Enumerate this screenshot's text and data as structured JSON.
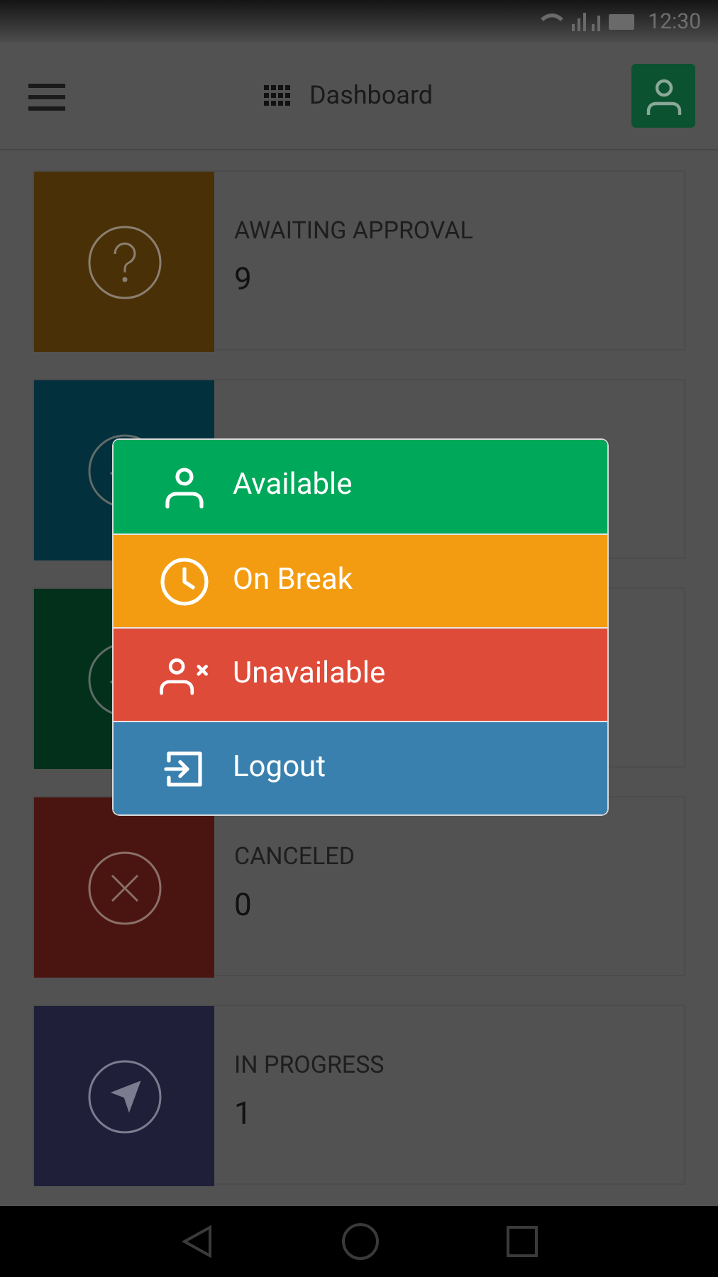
{
  "status_bar": {
    "time": "12:30"
  },
  "header": {
    "title": "Dashboard"
  },
  "cards": [
    {
      "kind": "question",
      "color": "#4a3007",
      "label": "AWAITING APPROVAL",
      "count": "9"
    },
    {
      "kind": "check",
      "color": "#03303d"
    },
    {
      "kind": "check",
      "color": "#02301b"
    },
    {
      "kind": "cancel",
      "color": "#4a1511",
      "label": "CANCELED",
      "count": "0"
    },
    {
      "kind": "navigate",
      "color": "#1f1f3a",
      "label": "IN PROGRESS",
      "count": "1"
    }
  ],
  "status_menu": [
    {
      "kind": "user",
      "color": "#00a85a",
      "label": "Available"
    },
    {
      "kind": "clock",
      "color": "#f39c12",
      "label": "On Break"
    },
    {
      "kind": "user-x",
      "color": "#df4b39",
      "label": "Unavailable"
    },
    {
      "kind": "logout",
      "color": "#3a80ae",
      "label": "Logout"
    }
  ]
}
